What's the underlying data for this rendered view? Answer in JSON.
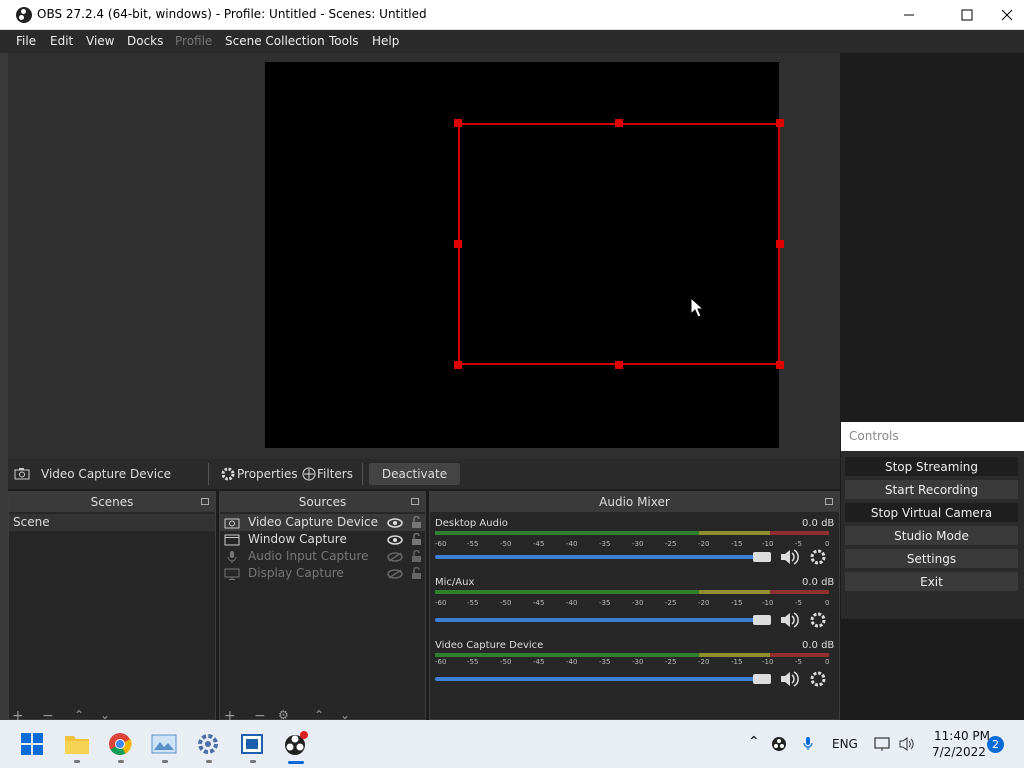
{
  "window": {
    "title": "OBS 27.2.4 (64-bit, windows) - Profile: Untitled - Scenes: Untitled"
  },
  "menu": [
    "File",
    "Edit",
    "View",
    "Docks",
    "Profile",
    "Scene Collection",
    "Tools",
    "Help"
  ],
  "source_toolbar": {
    "selected_source": "Video Capture Device",
    "properties_label": "Properties",
    "filters_label": "Filters",
    "deactivate_label": "Deactivate"
  },
  "scenes": {
    "header": "Scenes",
    "items": [
      "Scene"
    ]
  },
  "sources": {
    "header": "Sources",
    "items": [
      {
        "name": "Video Capture Device",
        "visible": true
      },
      {
        "name": "Window Capture",
        "visible": true
      },
      {
        "name": "Audio Input Capture",
        "visible": false
      },
      {
        "name": "Display Capture",
        "visible": false
      }
    ]
  },
  "audio_mixer": {
    "header": "Audio Mixer",
    "tick_labels": [
      "-60",
      "-55",
      "-50",
      "-45",
      "-40",
      "-35",
      "-30",
      "-25",
      "-20",
      "-15",
      "-10",
      "-5",
      "0"
    ],
    "channels": [
      {
        "name": "Desktop Audio",
        "level": "0.0 dB",
        "volume": 1.0
      },
      {
        "name": "Mic/Aux",
        "level": "0.0 dB",
        "volume": 1.0
      },
      {
        "name": "Video Capture Device",
        "level": "0.0 dB",
        "volume": 1.0
      }
    ]
  },
  "controls": {
    "header": "Controls",
    "buttons": [
      "Stop Streaming",
      "Start Recording",
      "Stop Virtual Camera",
      "Studio Mode",
      "Settings",
      "Exit"
    ]
  },
  "taskbar": {
    "language": "ENG",
    "time": "11:40 PM",
    "date": "7/2/2022",
    "notification_count": "2"
  },
  "colors": {
    "selection": "#d20000",
    "slider": "#3d7fd4"
  }
}
